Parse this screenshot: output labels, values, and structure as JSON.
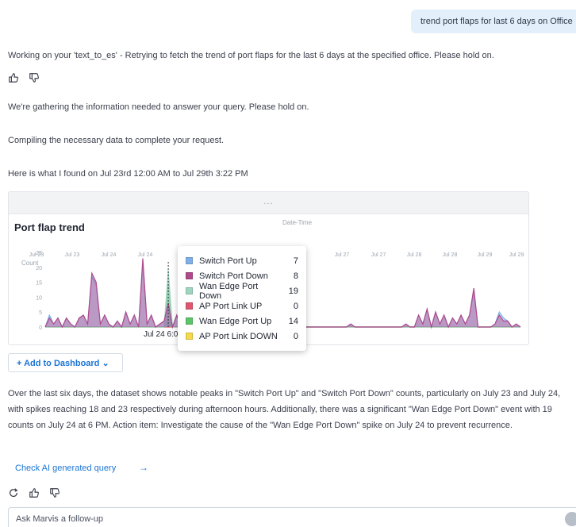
{
  "user_query": "trend port flaps for last 6 days on Office",
  "messages": {
    "working": "Working on your 'text_to_es' - Retrying to fetch the trend of port flaps for the last 6 days at the specified office. Please hold on.",
    "gathering": "We're gathering the information needed to answer your query. Please hold on.",
    "compiling": "Compiling the necessary data to complete your request.",
    "found": "Here is what I found on Jul 23rd 12:00 AM to Jul 29th 3:22 PM"
  },
  "chart_handle": "...",
  "chart_data": {
    "type": "area",
    "title": "Port flap trend",
    "xlabel": "Date-Time",
    "ylabel": "Count",
    "ylim": [
      0,
      25
    ],
    "y_ticks": [
      "0",
      "5",
      "10",
      "15",
      "20",
      "25"
    ],
    "x_ticks": [
      "Jul 23",
      "Jul 23",
      "Jul 24",
      "Jul 24",
      "Jul 27",
      "Jul 27",
      "Jul 28",
      "Jul 28",
      "Jul 29",
      "Jul 29"
    ],
    "hover_label": "Jul 24 6:0",
    "series": [
      {
        "name": "Switch Port Up",
        "color": "#7fb0e8",
        "values": [
          0,
          4,
          1,
          3,
          0,
          3,
          1,
          0,
          3,
          4,
          1,
          17,
          14,
          1,
          4,
          1,
          0,
          2,
          0,
          5,
          1,
          4,
          0,
          22,
          1,
          4,
          0,
          1,
          2,
          7,
          0,
          4,
          0,
          2,
          0,
          1,
          0,
          3,
          0,
          1,
          0,
          2,
          0,
          0,
          0,
          0,
          0,
          0,
          0,
          1,
          0,
          2,
          0,
          0,
          0,
          0,
          0,
          0,
          0,
          0,
          0,
          0,
          0,
          0,
          0,
          0,
          0,
          0,
          0,
          0,
          0,
          0,
          1,
          0,
          0,
          0,
          0,
          0,
          0,
          0,
          0,
          0,
          0,
          0,
          0,
          1,
          0,
          0,
          4,
          1,
          6,
          0,
          5,
          1,
          4,
          0,
          3,
          1,
          4,
          1,
          4,
          12,
          0,
          0,
          0,
          0,
          1,
          5,
          3,
          2,
          0,
          1,
          0
        ]
      },
      {
        "name": "Switch Port Down",
        "color": "#b04a8c",
        "values": [
          0,
          3,
          1,
          3,
          0,
          3,
          1,
          0,
          3,
          4,
          1,
          18,
          15,
          1,
          4,
          1,
          0,
          2,
          0,
          5,
          1,
          4,
          0,
          23,
          1,
          4,
          0,
          1,
          2,
          8,
          0,
          4,
          0,
          2,
          0,
          1,
          0,
          3,
          0,
          1,
          0,
          2,
          0,
          0,
          0,
          0,
          0,
          0,
          0,
          1,
          0,
          2,
          0,
          0,
          0,
          0,
          0,
          0,
          0,
          0,
          0,
          0,
          0,
          0,
          0,
          0,
          0,
          0,
          0,
          0,
          0,
          0,
          1,
          0,
          0,
          0,
          0,
          0,
          0,
          0,
          0,
          0,
          0,
          0,
          0,
          1,
          0,
          0,
          4,
          1,
          6,
          0,
          5,
          1,
          4,
          0,
          3,
          1,
          4,
          1,
          4,
          13,
          0,
          0,
          0,
          0,
          1,
          4,
          2,
          2,
          0,
          1,
          0
        ]
      },
      {
        "name": "Wan Edge Port Down",
        "color": "#9fd5c0",
        "values": [
          0,
          0,
          0,
          0,
          0,
          0,
          0,
          0,
          0,
          0,
          0,
          0,
          0,
          0,
          0,
          0,
          0,
          0,
          0,
          0,
          0,
          0,
          0,
          0,
          0,
          0,
          0,
          0,
          0,
          19,
          0,
          0,
          0,
          0,
          0,
          0,
          0,
          0,
          0,
          0,
          0,
          0,
          0,
          0,
          0,
          0,
          0,
          0,
          0,
          0,
          0,
          0,
          0,
          0,
          0,
          0,
          0,
          0,
          0,
          0,
          0,
          0,
          0,
          0,
          0,
          0,
          0,
          0,
          0,
          0,
          0,
          0,
          0,
          0,
          0,
          0,
          0,
          0,
          0,
          0,
          0,
          0,
          0,
          0,
          0,
          0,
          0,
          0,
          0,
          0,
          0,
          0,
          0,
          0,
          0,
          0,
          0,
          0,
          0,
          0,
          0,
          0,
          0,
          0,
          0,
          0,
          0,
          0,
          0,
          0,
          0,
          0,
          0
        ]
      },
      {
        "name": "AP Port Link UP",
        "color": "#e0556f",
        "values": [
          0,
          0,
          0,
          0,
          0,
          0,
          0,
          0,
          0,
          0,
          0,
          0,
          0,
          0,
          0,
          0,
          0,
          0,
          0,
          0,
          0,
          0,
          0,
          0,
          0,
          0,
          0,
          0,
          0,
          0,
          0,
          0,
          0,
          0,
          0,
          0,
          0,
          0,
          0,
          0,
          0,
          0,
          0,
          0,
          0,
          0,
          0,
          0,
          0,
          0,
          0,
          0,
          0,
          0,
          0,
          0,
          0,
          0,
          0,
          0,
          0,
          0,
          0,
          0,
          0,
          0,
          0,
          0,
          0,
          0,
          0,
          0,
          0,
          0,
          0,
          0,
          0,
          0,
          0,
          0,
          0,
          0,
          0,
          0,
          0,
          0,
          0,
          0,
          0,
          0,
          0,
          0,
          0,
          0,
          0,
          0,
          0,
          0,
          0,
          0,
          0,
          0,
          0,
          0,
          0,
          0,
          0,
          0,
          0,
          0,
          0,
          0,
          0
        ]
      },
      {
        "name": "Wan Edge Port Up",
        "color": "#5cc46a",
        "values": [
          0,
          0,
          0,
          0,
          0,
          0,
          0,
          0,
          0,
          0,
          0,
          0,
          0,
          0,
          0,
          0,
          0,
          0,
          0,
          0,
          0,
          0,
          0,
          0,
          0,
          0,
          0,
          0,
          0,
          14,
          0,
          0,
          0,
          0,
          0,
          0,
          0,
          0,
          0,
          0,
          0,
          0,
          0,
          0,
          0,
          0,
          0,
          0,
          0,
          0,
          0,
          0,
          0,
          0,
          0,
          0,
          0,
          0,
          0,
          0,
          0,
          0,
          0,
          0,
          0,
          0,
          0,
          0,
          0,
          0,
          0,
          0,
          0,
          0,
          0,
          0,
          0,
          0,
          0,
          0,
          0,
          0,
          0,
          0,
          0,
          0,
          0,
          0,
          0,
          0,
          0,
          0,
          0,
          0,
          0,
          0,
          0,
          0,
          0,
          0,
          0,
          0,
          0,
          0,
          0,
          0,
          0,
          0,
          0,
          0,
          0,
          0,
          0
        ]
      },
      {
        "name": "AP Port Link DOWN",
        "color": "#f5d94a",
        "values": [
          0,
          0,
          0,
          0,
          0,
          0,
          0,
          0,
          0,
          0,
          0,
          0,
          0,
          0,
          0,
          0,
          0,
          0,
          0,
          0,
          0,
          0,
          0,
          0,
          0,
          0,
          0,
          0,
          0,
          0,
          0,
          0,
          0,
          0,
          0,
          0,
          0,
          0,
          0,
          0,
          0,
          0,
          0,
          0,
          0,
          0,
          0,
          0,
          0,
          0,
          0,
          0,
          0,
          0,
          0,
          0,
          0,
          0,
          0,
          0,
          0,
          0,
          0,
          0,
          0,
          0,
          0,
          0,
          0,
          0,
          0,
          0,
          0,
          0,
          0,
          0,
          0,
          0,
          0,
          0,
          0,
          0,
          0,
          0,
          0,
          0,
          0,
          0,
          0,
          0,
          0,
          0,
          0,
          0,
          0,
          0,
          0,
          0,
          0,
          0,
          0,
          0,
          0,
          0,
          0,
          0,
          0,
          0,
          0,
          0,
          0,
          0,
          0
        ]
      }
    ],
    "tooltip": [
      {
        "label": "Switch Port Up",
        "value": "7"
      },
      {
        "label": "Switch Port Down",
        "value": "8"
      },
      {
        "label": "Wan Edge Port Down",
        "value": "19"
      },
      {
        "label": "AP Port Link UP",
        "value": "0"
      },
      {
        "label": "Wan Edge Port Up",
        "value": "14"
      },
      {
        "label": "AP Port Link DOWN",
        "value": "0"
      }
    ],
    "legend": "none",
    "grid": false
  },
  "add_dashboard_label": "+ Add to Dashboard ⌄",
  "summary": "Over the last six days, the dataset shows notable peaks in \"Switch Port Up\" and \"Switch Port Down\" counts, particularly on July 23 and July 24, with spikes reaching 18 and 23 respectively during afternoon hours. Additionally, there was a significant \"Wan Edge Port Down\" event with 19 counts on July 24 at 6 PM. Action item: Investigate the cause of the \"Wan Edge Port Down\" spike on July 24 to prevent recurrence.",
  "check_query_label": "Check AI generated query",
  "check_arrow": "→",
  "followup_placeholder": "Ask Marvis a follow-up"
}
